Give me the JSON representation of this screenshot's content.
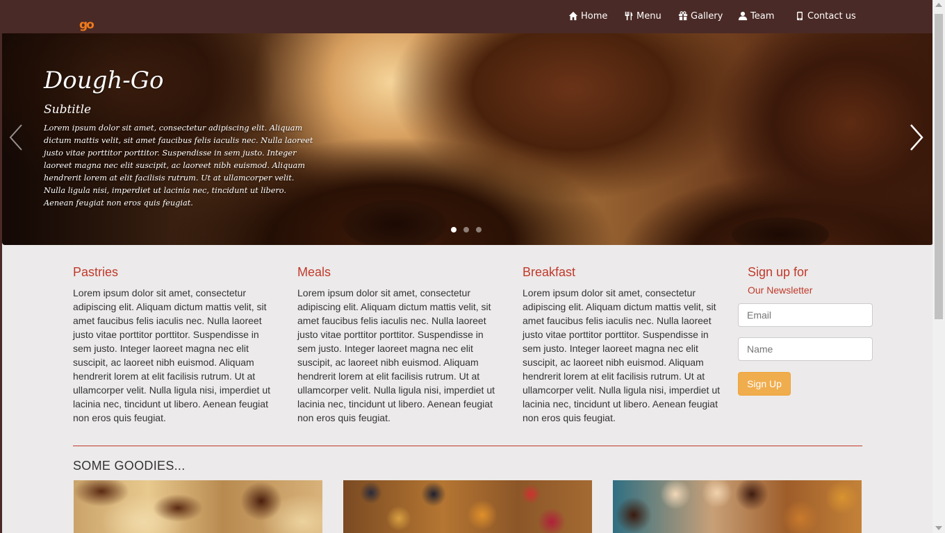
{
  "nav": {
    "logo_text": "go",
    "items": [
      {
        "label": "Home",
        "icon": "home-icon"
      },
      {
        "label": "Menu",
        "icon": "cutlery-icon"
      },
      {
        "label": "Gallery",
        "icon": "gift-icon"
      },
      {
        "label": "Team",
        "icon": "user-icon"
      },
      {
        "label": "Contact us",
        "icon": "phone-icon"
      }
    ]
  },
  "hero": {
    "title": "Dough-Go",
    "subtitle": "Subtitle",
    "text": "Lorem ipsum dolor sit amet, consectetur adipiscing elit. Aliquam dictum mattis velit, sit amet faucibus felis iaculis nec. Nulla laoreet justo vitae porttitor porttitor. Suspendisse in sem justo. Integer laoreet magna nec elit suscipit, ac laoreet nibh euismod. Aliquam hendrerit lorem at elit facilisis rutrum. Ut at ullamcorper velit. Nulla ligula nisi, imperdiet ut lacinia nec, tincidunt ut libero. Aenean feugiat non eros quis feugiat.",
    "slide_count": 3,
    "active_slide": 1
  },
  "columns": [
    {
      "title": "Pastries",
      "text": "Lorem ipsum dolor sit amet, consectetur adipiscing elit. Aliquam dictum mattis velit, sit amet faucibus felis iaculis nec. Nulla laoreet justo vitae porttitor porttitor. Suspendisse in sem justo. Integer laoreet magna nec elit suscipit, ac laoreet nibh euismod. Aliquam hendrerit lorem at elit facilisis rutrum. Ut at ullamcorper velit. Nulla ligula nisi, imperdiet ut lacinia nec, tincidunt ut libero. Aenean feugiat non eros quis feugiat."
    },
    {
      "title": "Meals",
      "text": "Lorem ipsum dolor sit amet, consectetur adipiscing elit. Aliquam dictum mattis velit, sit amet faucibus felis iaculis nec. Nulla laoreet justo vitae porttitor porttitor. Suspendisse in sem justo. Integer laoreet magna nec elit suscipit, ac laoreet nibh euismod. Aliquam hendrerit lorem at elit facilisis rutrum. Ut at ullamcorper velit. Nulla ligula nisi, imperdiet ut lacinia nec, tincidunt ut libero. Aenean feugiat non eros quis feugiat."
    },
    {
      "title": "Breakfast",
      "text": "Lorem ipsum dolor sit amet, consectetur adipiscing elit. Aliquam dictum mattis velit, sit amet faucibus felis iaculis nec. Nulla laoreet justo vitae porttitor porttitor. Suspendisse in sem justo. Integer laoreet magna nec elit suscipit, ac laoreet nibh euismod. Aliquam hendrerit lorem at elit facilisis rutrum. Ut at ullamcorper velit. Nulla ligula nisi, imperdiet ut lacinia nec, tincidunt ut libero. Aenean feugiat non eros quis feugiat."
    }
  ],
  "newsletter": {
    "title": "Sign up for",
    "subtitle": "Our Newsletter",
    "email_placeholder": "Email",
    "name_placeholder": "Name",
    "button_label": "Sign Up"
  },
  "goodies": {
    "title": "SOME GOODIES..."
  },
  "colors": {
    "navbar": "#4a2a26",
    "accent": "#c0392b",
    "button": "#f0ad4e",
    "logo": "#f07a1c"
  }
}
